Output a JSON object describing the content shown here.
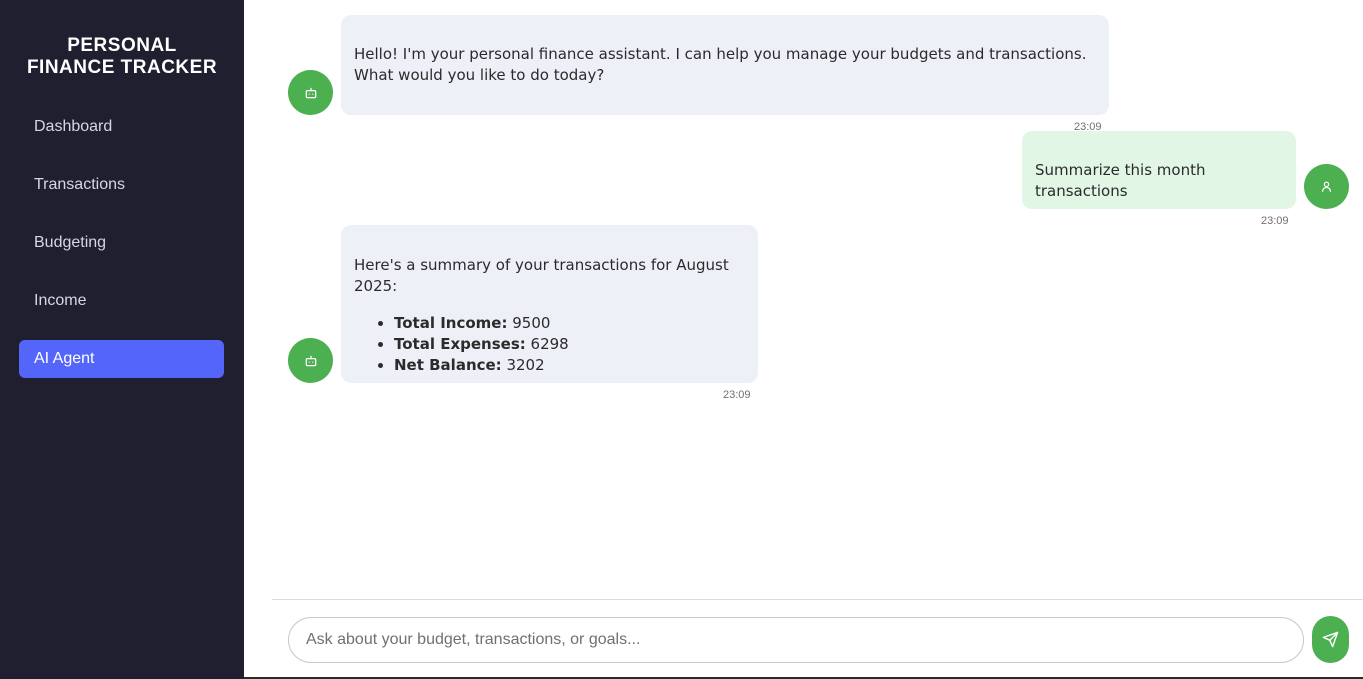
{
  "app": {
    "title_line1": "PERSONAL",
    "title_line2": "FINANCE TRACKER"
  },
  "sidebar": {
    "items": [
      {
        "label": "Dashboard",
        "active": false
      },
      {
        "label": "Transactions",
        "active": false
      },
      {
        "label": "Budgeting",
        "active": false
      },
      {
        "label": "Income",
        "active": false
      },
      {
        "label": "AI Agent",
        "active": true
      }
    ]
  },
  "chat": {
    "messages": [
      {
        "sender": "bot",
        "text": "Hello! I'm your personal finance assistant. I can help you manage your budgets and transactions. What would you like to do today?",
        "time": "23:09"
      },
      {
        "sender": "user",
        "text": "Summarize this month transactions",
        "time": "23:09"
      },
      {
        "sender": "bot",
        "intro": "Here's a summary of your transactions for August 2025:",
        "items": [
          {
            "label": "Total Income:",
            "value": "9500"
          },
          {
            "label": "Total Expenses:",
            "value": "6298"
          },
          {
            "label": "Net Balance:",
            "value": "3202"
          }
        ],
        "time": "23:09"
      }
    ]
  },
  "input": {
    "placeholder": "Ask about your budget, transactions, or goals...",
    "value": ""
  },
  "colors": {
    "sidebar_bg": "#1f1f30",
    "accent": "#5466f9",
    "green": "#4caf50",
    "bot_bubble": "#edf0f7",
    "user_bubble": "#e2f6e6"
  },
  "icons": {
    "bot_avatar": "robot-icon",
    "user_avatar": "user-icon",
    "send": "send-icon"
  }
}
